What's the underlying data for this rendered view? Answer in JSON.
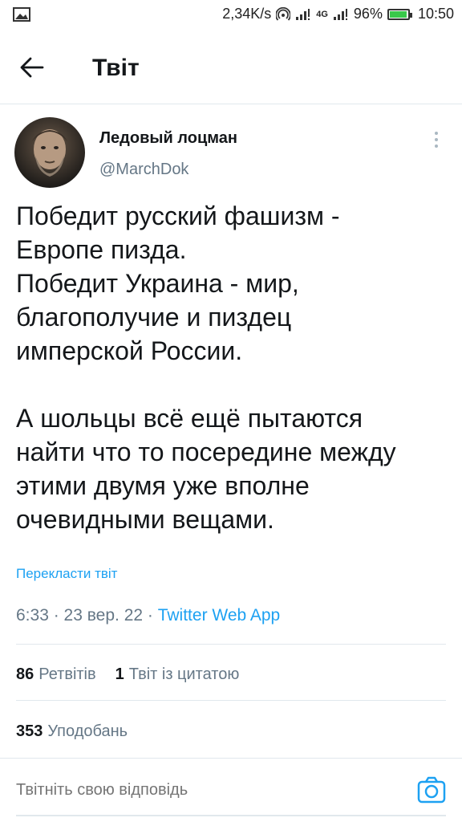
{
  "status_bar": {
    "speed": "2,34K/s",
    "network": "4G",
    "battery": "96%",
    "battery_level": 0.96,
    "time": "10:50"
  },
  "header": {
    "title": "Твіт"
  },
  "tweet": {
    "author_name": "Ледовый лоцман",
    "author_handle": "@MarchDok",
    "text": "Победит русский фашизм -\nЕвропе пизда.\nПобедит Украина - мир,\nблагополучие и пиздец\nимперской России.\n\nА шольцы всё ещё пытаются\nнайти что то посередине между\nэтими двумя уже вполне\nочевидными вещами.",
    "translate_label": "Перекласти твіт",
    "time": "6:33",
    "date": "23 вер. 22",
    "source": "Twitter Web App",
    "retweets_count": "86",
    "retweets_label": "Ретвітів",
    "quotes_count": "1",
    "quotes_label": "Твіт із цитатою",
    "likes_count": "353",
    "likes_label": "Уподобань"
  },
  "reply": {
    "placeholder": "Твітніть свою відповідь"
  },
  "colors": {
    "accent": "#1da1f2",
    "text_primary": "#14171a",
    "text_secondary": "#657786",
    "divider": "#e1e8ed",
    "battery": "#39c84a"
  }
}
